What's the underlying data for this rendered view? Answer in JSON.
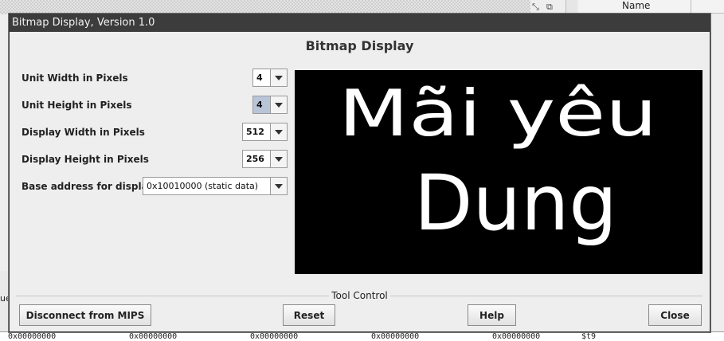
{
  "background": {
    "table_header": "Name",
    "left_edge_text": "ue",
    "bottom_cells": [
      "0x00000000",
      "0x00000000",
      "0x00000000",
      "0x00000000",
      "0x00000000",
      "$t9"
    ]
  },
  "dialog": {
    "title": "Bitmap Display, Version 1.0",
    "heading": "Bitmap Display",
    "fields": [
      {
        "label": "Unit Width in Pixels",
        "value": "4"
      },
      {
        "label": "Unit Height in Pixels",
        "value": "4"
      },
      {
        "label": "Display Width in Pixels",
        "value": "512"
      },
      {
        "label": "Display Height in Pixels",
        "value": "256"
      },
      {
        "label": "Base address for display",
        "value": "0x10010000 (static data)"
      }
    ],
    "display": {
      "line1": "Mãi yêu",
      "line2": "Dung"
    },
    "tool_control": {
      "title": "Tool Control",
      "disconnect": "Disconnect from MIPS",
      "reset": "Reset",
      "help": "Help",
      "close": "Close"
    }
  }
}
